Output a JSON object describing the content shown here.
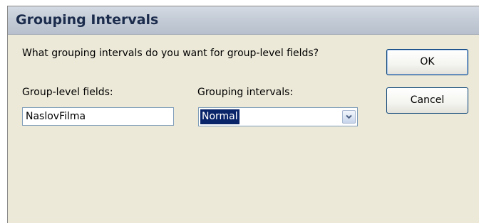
{
  "window": {
    "title": "Grouping Intervals"
  },
  "dialog": {
    "prompt": "What grouping intervals do you want for group-level fields?",
    "group_fields_label": "Group-level fields:",
    "grouping_intervals_label": "Grouping intervals:",
    "group_field_value": "NaslovFilma",
    "grouping_interval_selected": "Normal"
  },
  "buttons": {
    "ok_label": "OK",
    "cancel_label": "Cancel"
  },
  "colors": {
    "dialog_background": "#ece9d8",
    "selection_highlight": "#0a246a",
    "button_border": "#003c74"
  },
  "icons": {
    "dropdown": "chevron-down-icon"
  }
}
